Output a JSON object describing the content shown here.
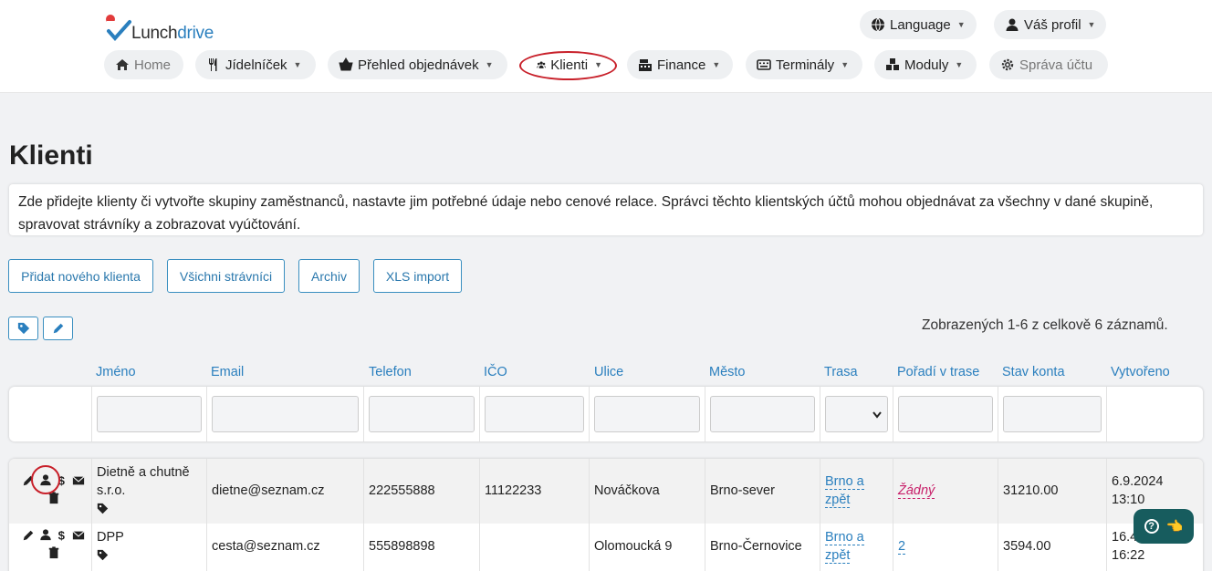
{
  "brand": {
    "name_part1": "Lunch",
    "name_part2": "drive"
  },
  "header": {
    "language": "Language",
    "profile": "Váš profil"
  },
  "nav": {
    "home": "Home",
    "menu": "Jídelníček",
    "orders": "Přehled objednávek",
    "clients": "Klienti",
    "finance": "Finance",
    "terminals": "Terminály",
    "modules": "Moduly",
    "account": "Správa účtu"
  },
  "page": {
    "title": "Klienti",
    "description": "Zde přidejte klienty či vytvořte skupiny zaměstnanců, nastavte jim potřebné údaje nebo cenové relace. Správci těchto klientských účtů mohou objednávat za všechny v dané skupině, spravovat strávníky a zobrazovat vyúčtování."
  },
  "actions": {
    "add_client": "Přidat nového klienta",
    "all_diners": "Všichni strávníci",
    "archive": "Archiv",
    "xls_import": "XLS import"
  },
  "summary": "Zobrazených 1-6 z celkově 6 záznamů.",
  "table": {
    "columns": {
      "name": "Jméno",
      "email": "Email",
      "phone": "Telefon",
      "ico": "IČO",
      "street": "Ulice",
      "city": "Město",
      "route": "Trasa",
      "route_order": "Pořadí v trase",
      "balance": "Stav konta",
      "created": "Vytvořeno"
    },
    "rows": [
      {
        "name_line1": "Dietně a chutně",
        "name_line2": "s.r.o.",
        "email": "dietne@seznam.cz",
        "phone": "222555888",
        "ico": "11122233",
        "street": "Nováčkova",
        "city": "Brno-sever",
        "route_line1": "Brno a",
        "route_line2": "zpět",
        "route_order": "Žádný",
        "balance": "31210.00",
        "created_date": "6.9.2024",
        "created_time": "13:10"
      },
      {
        "name_line1": "DPP",
        "email": "cesta@seznam.cz",
        "phone": "555898898",
        "ico": "",
        "street": "Olomoucká 9",
        "city": "Brno-Černovice",
        "route_line1": "Brno a",
        "route_line2": "zpět",
        "route_order": "2",
        "balance": "3594.00",
        "created_date": "16.4.",
        "created_time": "16:22"
      }
    ]
  },
  "colors": {
    "accent": "#2a7fbe",
    "highlight": "#c8202a",
    "help": "#175c5e"
  }
}
